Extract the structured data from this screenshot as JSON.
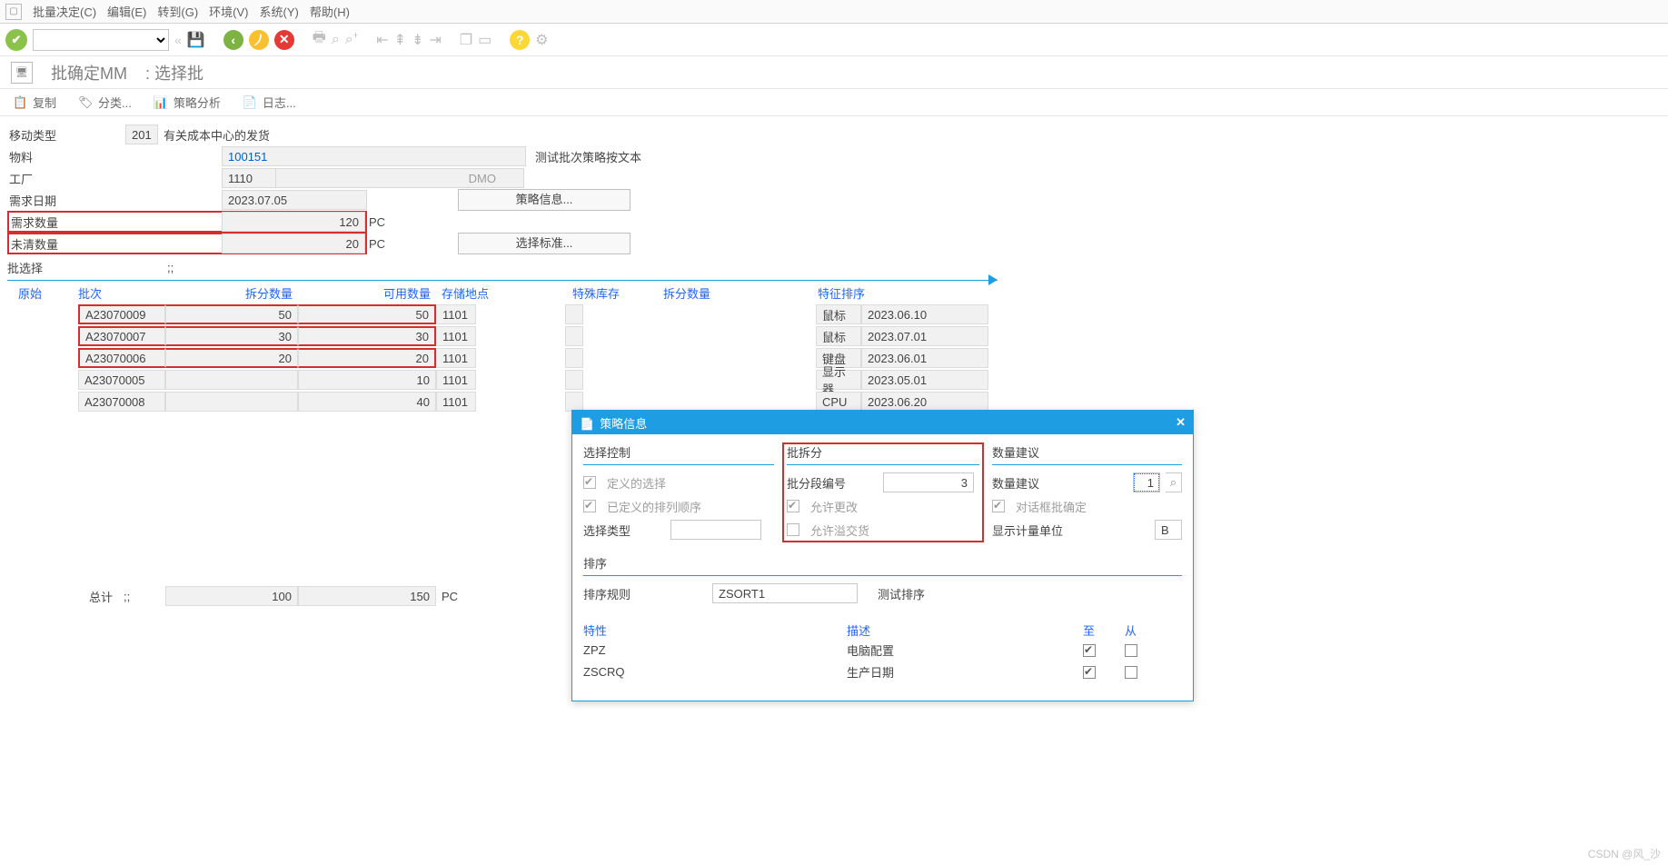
{
  "menu": {
    "items": [
      "批量决定(C)",
      "编辑(E)",
      "转到(G)",
      "环境(V)",
      "系统(Y)",
      "帮助(H)"
    ]
  },
  "title": {
    "main": "批确定MM",
    "sub": ": 选择批"
  },
  "subtoolbar": {
    "copy": "复制",
    "classify": "分类...",
    "strategy": "策略分析",
    "log": "日志..."
  },
  "form": {
    "move_type_lbl": "移动类型",
    "move_type": "201",
    "move_type_desc": "有关成本中心的发货",
    "material_lbl": "物料",
    "material": "100151",
    "material_desc": "测试批次策略按文本",
    "plant_lbl": "工厂",
    "plant": "1110",
    "plant_desc": "DMO",
    "reqdate_lbl": "需求日期",
    "reqdate": "2023.07.05",
    "reqqty_lbl": "需求数量",
    "reqqty": "120",
    "uom": "PC",
    "openqty_lbl": "未清数量",
    "openqty": "20",
    "uom2": "PC",
    "strategy_btn": "策略信息...",
    "criteria_btn": "选择标准..."
  },
  "batch_select_lbl": "批选择",
  "batch_select_marker": ";;",
  "grid_headers": {
    "orig": "原始",
    "batch": "批次",
    "split": "拆分数量",
    "avail": "可用数量",
    "sloc": "存储地点",
    "special": "特殊库存",
    "split2": "拆分数量",
    "charsort": "特征排序"
  },
  "rows": [
    {
      "batch": "A23070009",
      "split": "50",
      "avail": "50",
      "sloc": "1101",
      "char": "鼠标",
      "date": "2023.06.10",
      "red": true
    },
    {
      "batch": "A23070007",
      "split": "30",
      "avail": "30",
      "sloc": "1101",
      "char": "鼠标",
      "date": "2023.07.01",
      "red": true
    },
    {
      "batch": "A23070006",
      "split": "20",
      "avail": "20",
      "sloc": "1101",
      "char": "键盘",
      "date": "2023.06.01",
      "red": true
    },
    {
      "batch": "A23070005",
      "split": "",
      "avail": "10",
      "sloc": "1101",
      "char": "显示器",
      "date": "2023.05.01",
      "red": false
    },
    {
      "batch": "A23070008",
      "split": "",
      "avail": "40",
      "sloc": "1101",
      "char": "CPU",
      "date": "2023.06.20",
      "red": false
    }
  ],
  "totals": {
    "lbl": "总计",
    "marker": ";;",
    "split": "100",
    "avail": "150",
    "uom": "PC"
  },
  "dialog": {
    "title": "策略信息",
    "select_ctrl": "选择控制",
    "def_sel": "定义的选择",
    "def_sort": "已定义的排列顺序",
    "sel_type": "选择类型",
    "split": "批拆分",
    "split_no_lbl": "批分段编号",
    "split_no": "3",
    "allow_change": "允许更改",
    "allow_over": "允许溢交货",
    "qty": "数量建议",
    "qty_suggest": "数量建议",
    "qty_val": "1",
    "dlg_confirm": "对话框批确定",
    "disp_uom": "显示计量单位",
    "disp_uom_v": "B",
    "sort": "排序",
    "sort_rule_lbl": "排序规则",
    "sort_rule": "ZSORT1",
    "sort_desc": "测试排序",
    "char_hdr": "特性",
    "desc_hdr": "描述",
    "to_hdr": "至",
    "from_hdr": "从",
    "sort_rows": [
      {
        "c": "ZPZ",
        "d": "电脑配置",
        "to": true,
        "from": false
      },
      {
        "c": "ZSCRQ",
        "d": "生产日期",
        "to": true,
        "from": false
      }
    ]
  },
  "watermark": "CSDN @风_沙"
}
